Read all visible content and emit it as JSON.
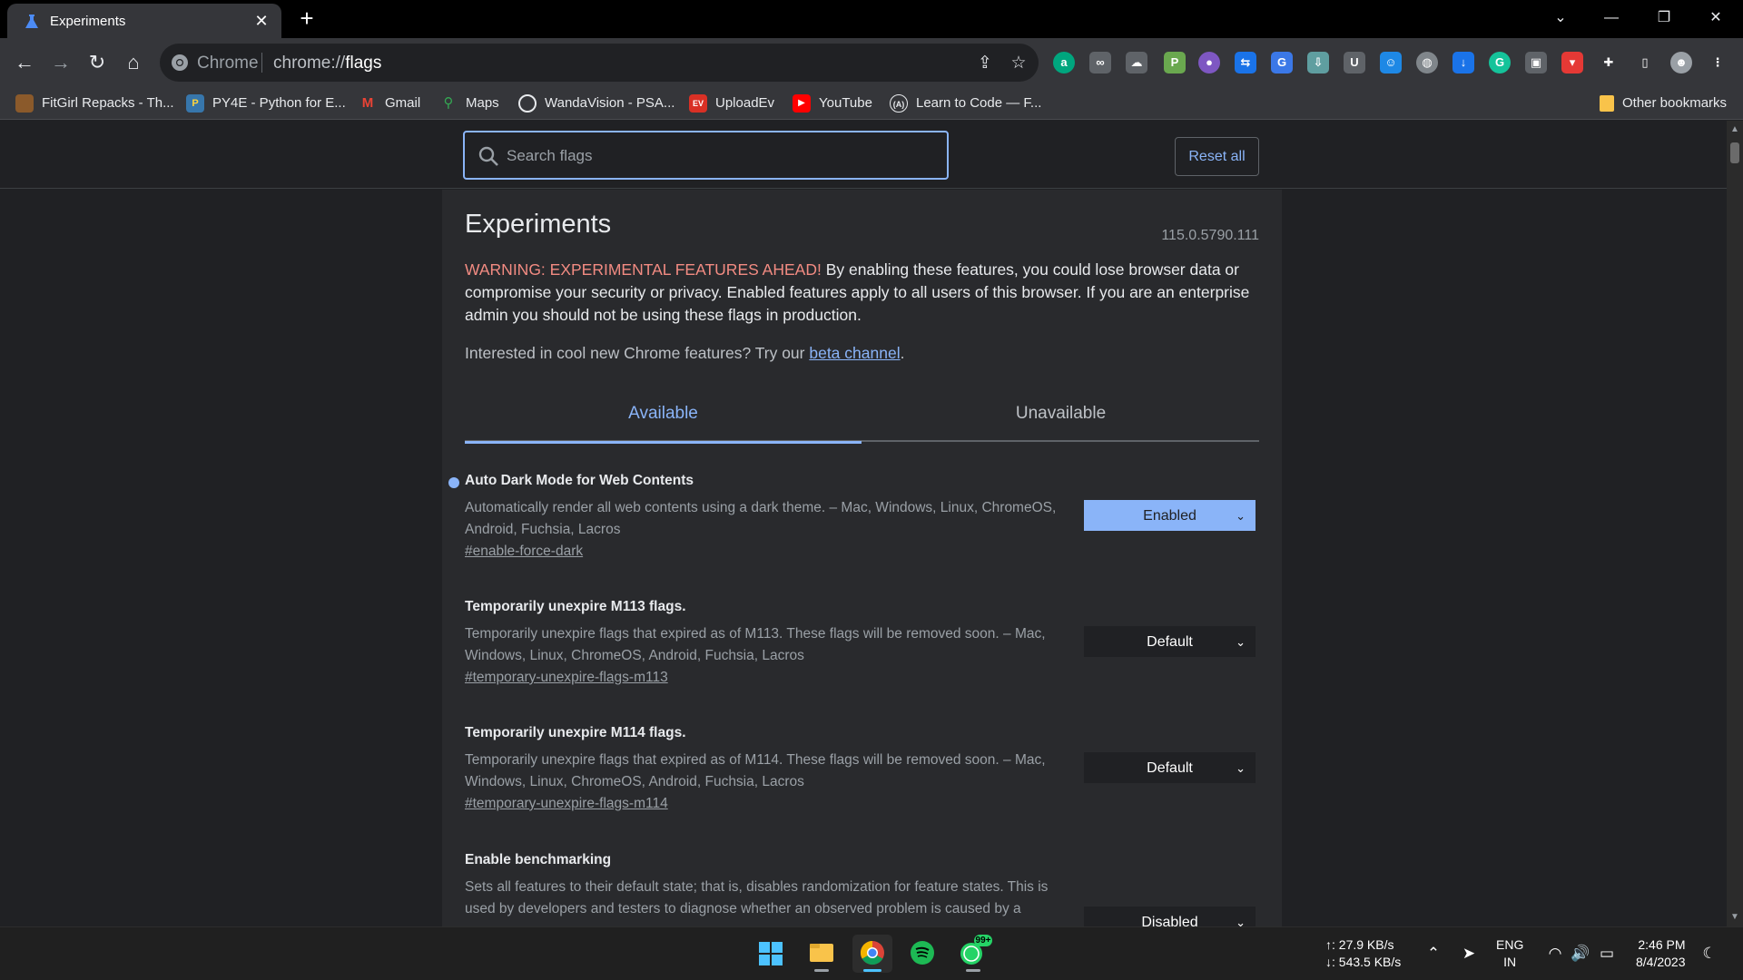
{
  "browser": {
    "tab": {
      "title": "Experiments",
      "close": "✕"
    },
    "new_tab": "+",
    "window_controls": {
      "dropdown": "⌄",
      "minimize": "—",
      "restore": "❐",
      "close": "✕"
    },
    "omnibox": {
      "scheme_label": "Chrome",
      "url_prefix": "chrome://",
      "url_host": "flags"
    },
    "bookmarks": [
      {
        "label": "FitGirl Repacks - Th...",
        "icon": "fitgirl-icon",
        "color": "#8b5a2b"
      },
      {
        "label": "PY4E - Python for E...",
        "icon": "python-icon",
        "color": "#3776ab"
      },
      {
        "label": "Gmail",
        "icon": "gmail-icon",
        "color": "#ea4335"
      },
      {
        "label": "Maps",
        "icon": "maps-icon",
        "color": "#34a853"
      },
      {
        "label": "WandaVision - PSA...",
        "icon": "psa-icon",
        "color": "#e8eaed"
      },
      {
        "label": "UploadEv",
        "icon": "uploadev-icon",
        "color": "#d93025"
      },
      {
        "label": "YouTube",
        "icon": "youtube-icon",
        "color": "#ff0000"
      },
      {
        "label": "Learn to Code — F...",
        "icon": "freecodecamp-icon",
        "color": "#0a0a23"
      }
    ],
    "other_bookmarks": "Other bookmarks"
  },
  "page": {
    "search_placeholder": "Search flags",
    "reset_label": "Reset all",
    "title": "Experiments",
    "version": "115.0.5790.111",
    "warning_strong": "WARNING: EXPERIMENTAL FEATURES AHEAD!",
    "warning_text": " By enabling these features, you could lose browser data or compromise your security or privacy. Enabled features apply to all users of this browser. If you are an enterprise admin you should not be using these flags in production.",
    "promo_prefix": "Interested in cool new Chrome features? Try our ",
    "promo_link": "beta channel",
    "promo_suffix": ".",
    "tabs": {
      "available": "Available",
      "unavailable": "Unavailable"
    },
    "flags": [
      {
        "name": "Auto Dark Mode for Web Contents",
        "description": "Automatically render all web contents using a dark theme. – Mac, Windows, Linux, ChromeOS, Android, Fuchsia, Lacros",
        "link": "#enable-force-dark",
        "value": "Enabled",
        "modified": true
      },
      {
        "name": "Temporarily unexpire M113 flags.",
        "description": "Temporarily unexpire flags that expired as of M113. These flags will be removed soon. – Mac, Windows, Linux, ChromeOS, Android, Fuchsia, Lacros",
        "link": "#temporary-unexpire-flags-m113",
        "value": "Default",
        "modified": false
      },
      {
        "name": "Temporarily unexpire M114 flags.",
        "description": "Temporarily unexpire flags that expired as of M114. These flags will be removed soon. – Mac, Windows, Linux, ChromeOS, Android, Fuchsia, Lacros",
        "link": "#temporary-unexpire-flags-m114",
        "value": "Default",
        "modified": false
      },
      {
        "name": "Enable benchmarking",
        "description": "Sets all features to their default state; that is, disables randomization for feature states. This is used by developers and testers to diagnose whether an observed problem is caused by a",
        "link": "",
        "value": "Disabled",
        "modified": false
      }
    ]
  },
  "taskbar": {
    "network_up": "↑: 27.9 KB/s",
    "network_down": "↓: 543.5 KB/s",
    "lang_1": "ENG",
    "lang_2": "IN",
    "time": "2:46 PM",
    "date": "8/4/2023",
    "whatsapp_badge": "99+"
  },
  "colors": {
    "accent": "#8ab4f8",
    "warning": "#f28b82",
    "background": "#202124",
    "card": "#292a2d"
  }
}
